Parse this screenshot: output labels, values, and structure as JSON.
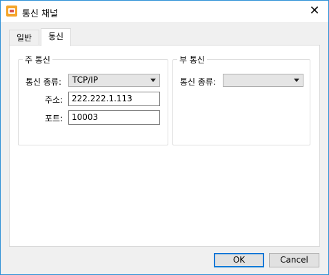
{
  "window": {
    "title": "통신 채널",
    "close_glyph": "✕"
  },
  "tabs": [
    {
      "label": "일반",
      "active": false
    },
    {
      "label": "통신",
      "active": true
    }
  ],
  "primary": {
    "group_title": "주 통신",
    "type_label": "통신 종류:",
    "type_value": "TCP/IP",
    "address_label": "주소:",
    "address_value": "222.222.1.113",
    "port_label": "포트:",
    "port_value": "10003"
  },
  "secondary": {
    "group_title": "부 통신",
    "type_label": "통신 종류:",
    "type_value": ""
  },
  "buttons": {
    "ok": "OK",
    "cancel": "Cancel"
  },
  "colors": {
    "window_border": "#2b8fd6",
    "default_button_border": "#0078d7",
    "app_icon": "#f4a52a"
  },
  "icons": {
    "app": "app-icon",
    "close": "close-icon",
    "dropdown": "chevron-down-icon"
  }
}
